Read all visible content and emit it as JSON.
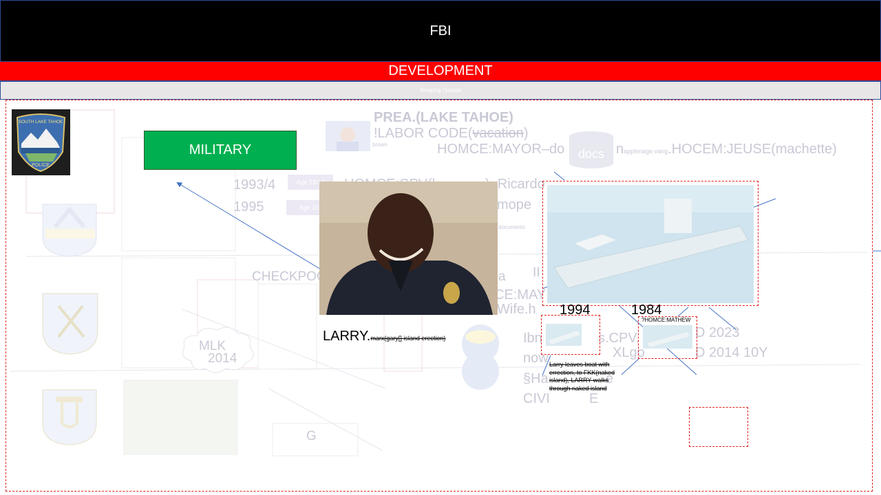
{
  "header": {
    "title": "FBI",
    "subtitle": "DEVELOPMENT",
    "tagline": "Sleeping Outside"
  },
  "military_label": "MILITARY",
  "background_text": {
    "prea": "PREA.(LAKE TAHOE)",
    "labor_code_prefix": "!LABOR CODE(",
    "labor_code_struck": "vacation",
    "labor_code_suffix": ")",
    "brown": "brown",
    "homce_mayor": "HOMCE:MAYOR–do",
    "homce_mayor_mid": "n",
    "small_text": "applenage.vang",
    "hocem_jeuse": ".HOCEM:JEUSE(machette)",
    "docs": "docs",
    "year_1993": "1993/4",
    "year_1995": "1995",
    "age_13": "Age 13/14",
    "age_15": "Age 15",
    "homce_cpv": "HOMCE:CPV(l",
    "ricardo": "). Ricardo",
    "mope": "mope",
    "documents": "documents",
    "checkpoint": "CHECKPOO",
    "a_char": "a",
    "ce_may": "CE:MAY",
    "wife": "Wife.h",
    "ii": "II",
    "ibn": "Ibn",
    "cpv": "s.CPV.",
    "d2023": "D 2023",
    "now": "now",
    "xlgo": "XLgo",
    "d2014": "D 2014 10Y",
    "sha": "§Ha",
    "e_char": "e",
    "civil": "CIVI",
    "e_char2": "E",
    "mlk": "MLK",
    "mlk_year": "2014",
    "g_char": "G"
  },
  "photo_caption": {
    "name": "LARRY.",
    "struck": "marx(gary[] island erection)"
  },
  "ship_section": {
    "year_left": "1994",
    "year_right": "1984",
    "homce_mathew": "?HOMCE:MATHEW",
    "note": "Larry leaves boat with errection, to FKK(naked island), LARRY walks through naked island"
  },
  "badge": {
    "top_text": "SOUTH LAKE TAHOE",
    "bottom_text": "POLICE"
  },
  "colors": {
    "header_bg": "#000000",
    "development_bg": "#ff0000",
    "military_bg": "#00b050",
    "arrow": "#4472c4",
    "dashed_border": "#e02020"
  }
}
